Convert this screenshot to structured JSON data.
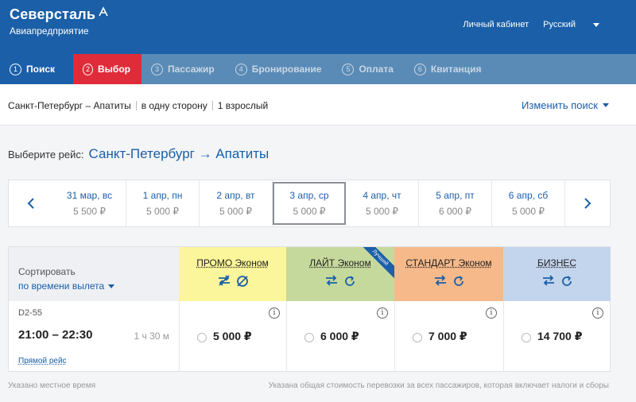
{
  "brand": {
    "name": "Северсталь",
    "subtitle": "Авиапредприятие"
  },
  "header": {
    "account_link": "Личный кабинет",
    "language": "Русский"
  },
  "steps": [
    {
      "num": "1",
      "label": "Поиск"
    },
    {
      "num": "2",
      "label": "Выбор"
    },
    {
      "num": "3",
      "label": "Пассажир"
    },
    {
      "num": "4",
      "label": "Бронирование"
    },
    {
      "num": "5",
      "label": "Оплата"
    },
    {
      "num": "6",
      "label": "Квитанция"
    }
  ],
  "search_summary": {
    "route": "Санкт-Петербург – Апатиты",
    "trip_type": "в одну сторону",
    "passengers": "1 взрослый",
    "change_label": "Изменить поиск"
  },
  "choose": {
    "prompt": "Выберите рейс:",
    "route": "Санкт-Петербург → Апатиты"
  },
  "dates": {
    "prev_icon": "chevron-left-icon",
    "next_icon": "chevron-right-icon",
    "items": [
      {
        "date": "31 мар, вс",
        "price": "5 500 ₽"
      },
      {
        "date": "1 апр, пн",
        "price": "5 000 ₽"
      },
      {
        "date": "2 апр, вт",
        "price": "5 000 ₽"
      },
      {
        "date": "3 апр, ср",
        "price": "5 000 ₽",
        "selected": true
      },
      {
        "date": "4 апр, чт",
        "price": "5 000 ₽"
      },
      {
        "date": "5 апр, пт",
        "price": "6 000 ₽"
      },
      {
        "date": "6 апр, сб",
        "price": "5 000 ₽"
      }
    ]
  },
  "sort": {
    "label": "Сортировать",
    "value": "по времени вылета"
  },
  "fare_classes": [
    {
      "name": "ПРОМО Эконом",
      "color": "#fbf59b"
    },
    {
      "name": "ЛАЙТ Эконом",
      "color": "#c6d99c",
      "badge": "Лучший"
    },
    {
      "name": "СТАНДАРТ Эконом",
      "color": "#f6b98a"
    },
    {
      "name": "БИЗНЕС",
      "color": "#c3d5ec"
    }
  ],
  "flight": {
    "code": "D2-55",
    "time": "21:00 – 22:30",
    "duration": "1 ч 30 м",
    "direct_label": "Прямой рейс",
    "prices": [
      "5 000 ₽",
      "6 000 ₽",
      "7 000 ₽",
      "14 700 ₽"
    ]
  },
  "footer": {
    "local_time_note": "Указано местное время",
    "price_note": "Указана общая стоимость перевозки за всех пассажиров, которая включает налоги и сборы"
  },
  "colors": {
    "header": "#1a5fa8",
    "steps_bar": "#5a8bb6",
    "active_step": "#e02b3a",
    "link": "#1a5fa8"
  }
}
